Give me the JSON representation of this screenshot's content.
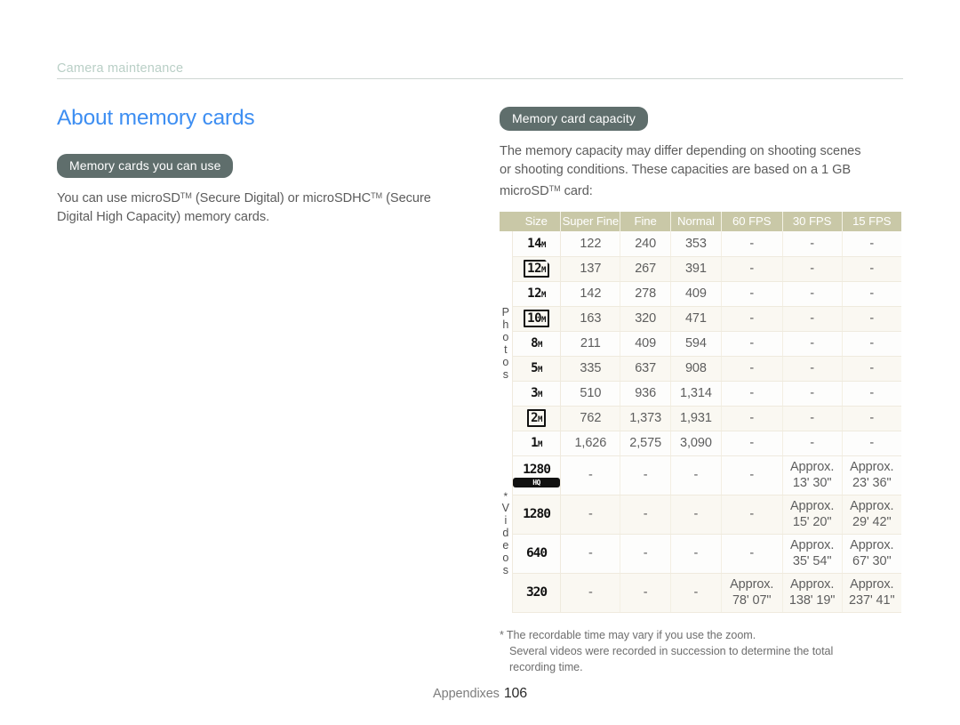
{
  "running_head": "Camera maintenance",
  "left_column": {
    "title": "About memory cards",
    "section": {
      "pill": "Memory cards you can use",
      "paragraph_line1_a": "You can use microSD",
      "paragraph_line1_tm1": "TM",
      "paragraph_line1_b": " (Secure Digital) or microSDHC",
      "paragraph_line1_tm2": "TM",
      "paragraph_line1_c": " (Secure",
      "paragraph_line2": "Digital High Capacity) memory cards."
    }
  },
  "right_column": {
    "pill": "Memory card capacity",
    "intro_line1": "The memory capacity may differ depending on shooting scenes",
    "intro_line2": "or shooting conditions. These capacities are based on a 1 GB",
    "intro_line3_a": "microSD",
    "intro_line3_tm": "TM",
    "intro_line3_b": " card:",
    "footnote_line1_star": "*",
    "footnote_line1": "The recordable time may vary if you use the zoom.",
    "footnote_line2": "Several videos were recorded in succession to determine the total",
    "footnote_line3": "recording time."
  },
  "table": {
    "headers": [
      "",
      "Size",
      "Super Fine",
      "Fine",
      "Normal",
      "60 FPS",
      "30 FPS",
      "15 FPS"
    ],
    "group_photos_label": "Photos",
    "group_videos_label": "Videos",
    "group_videos_star": "*",
    "photo_rows": [
      {
        "icon": "14M",
        "icon_style": "plain",
        "super_fine": "122",
        "fine": "240",
        "normal": "353",
        "fps60": "-",
        "fps30": "-",
        "fps15": "-"
      },
      {
        "icon": "12M",
        "icon_style": "wide",
        "super_fine": "137",
        "fine": "267",
        "normal": "391",
        "fps60": "-",
        "fps30": "-",
        "fps15": "-"
      },
      {
        "icon": "12M",
        "icon_style": "plain",
        "super_fine": "142",
        "fine": "278",
        "normal": "409",
        "fps60": "-",
        "fps30": "-",
        "fps15": "-"
      },
      {
        "icon": "10M",
        "icon_style": "boxed",
        "super_fine": "163",
        "fine": "320",
        "normal": "471",
        "fps60": "-",
        "fps30": "-",
        "fps15": "-"
      },
      {
        "icon": "8M",
        "icon_style": "plain",
        "super_fine": "211",
        "fine": "409",
        "normal": "594",
        "fps60": "-",
        "fps30": "-",
        "fps15": "-"
      },
      {
        "icon": "5M",
        "icon_style": "plain",
        "super_fine": "335",
        "fine": "637",
        "normal": "908",
        "fps60": "-",
        "fps30": "-",
        "fps15": "-"
      },
      {
        "icon": "3M",
        "icon_style": "plain",
        "super_fine": "510",
        "fine": "936",
        "normal": "1,314",
        "fps60": "-",
        "fps30": "-",
        "fps15": "-"
      },
      {
        "icon": "2M",
        "icon_style": "boxed",
        "super_fine": "762",
        "fine": "1,373",
        "normal": "1,931",
        "fps60": "-",
        "fps30": "-",
        "fps15": "-"
      },
      {
        "icon": "1M",
        "icon_style": "plain",
        "super_fine": "1,626",
        "fine": "2,575",
        "normal": "3,090",
        "fps60": "-",
        "fps30": "-",
        "fps15": "-"
      }
    ],
    "video_rows": [
      {
        "icon": "1280",
        "badge": "HQ",
        "super_fine": "-",
        "fine": "-",
        "normal": "-",
        "fps60": "-",
        "fps30_a": "Approx.",
        "fps30_b": "13' 30\"",
        "fps15_a": "Approx.",
        "fps15_b": "23' 36\""
      },
      {
        "icon": "1280",
        "badge": "",
        "super_fine": "-",
        "fine": "-",
        "normal": "-",
        "fps60": "-",
        "fps30_a": "Approx.",
        "fps30_b": "15' 20\"",
        "fps15_a": "Approx.",
        "fps15_b": "29' 42\""
      },
      {
        "icon": "640",
        "badge": "",
        "super_fine": "-",
        "fine": "-",
        "normal": "-",
        "fps60": "-",
        "fps30_a": "Approx.",
        "fps30_b": "35' 54\"",
        "fps15_a": "Approx.",
        "fps15_b": "67' 30\""
      },
      {
        "icon": "320",
        "badge": "",
        "super_fine": "-",
        "fine": "-",
        "normal": "-",
        "fps60_a": "Approx.",
        "fps60_b": "78' 07\"",
        "fps30_a": "Approx.",
        "fps30_b": "138' 19\"",
        "fps15_a": "Approx.",
        "fps15_b": "237' 41\""
      }
    ]
  },
  "footer": {
    "label": "Appendixes",
    "page_number": "106"
  },
  "colors": {
    "title_blue": "#3d8ef2",
    "pill_bg": "#5f6e6c",
    "table_header_bg": "#c9c8a7",
    "running_head": "#b9cfc6",
    "body_text": "#5c5c5c"
  }
}
